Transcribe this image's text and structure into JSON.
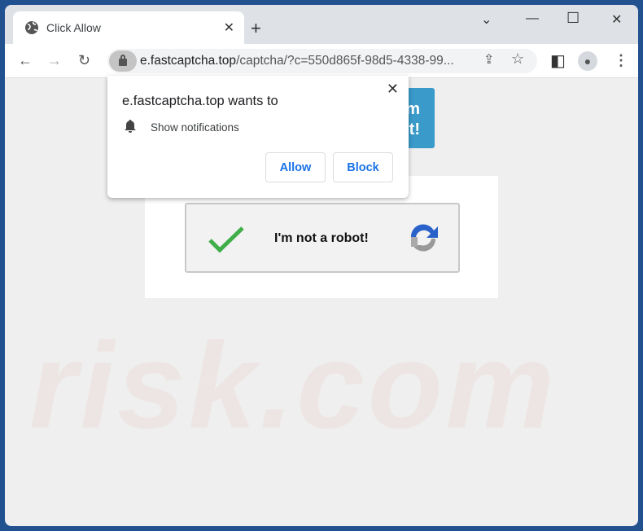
{
  "tab": {
    "title": "Click Allow",
    "icon": "globe-icon"
  },
  "address": {
    "domain": "e.fastcaptcha.top",
    "path": "/captcha/?c=550d865f-98d5-4338-99..."
  },
  "page": {
    "blue_fragment_1": "m",
    "blue_fragment_2": "t!",
    "captcha_label": "I'm not a robot!",
    "watermark": "risk.com"
  },
  "popup": {
    "title": "e.fastcaptcha.top wants to",
    "permission": "Show notifications",
    "allow": "Allow",
    "block": "Block"
  },
  "colors": {
    "frame": "#225190",
    "accent": "#1a73e8",
    "check": "#3fae49",
    "blue_box": "#3a9ac9"
  }
}
